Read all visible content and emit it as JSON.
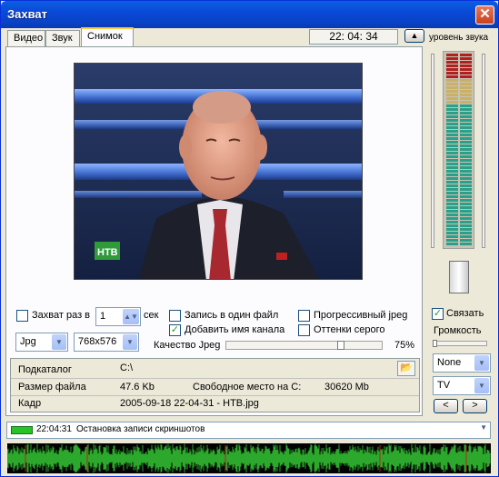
{
  "window": {
    "title": "Захват"
  },
  "tabs": [
    {
      "label": "Видео",
      "active": false
    },
    {
      "label": "Звук",
      "active": false
    },
    {
      "label": "Снимок",
      "active": true
    }
  ],
  "clock": "22: 04: 34",
  "level_label": "уровень звука",
  "video": {
    "channel_logo": "НТВ"
  },
  "capture": {
    "every_label": "Захват раз в",
    "every_checked": false,
    "interval_value": "1",
    "interval_unit": "сек",
    "single_file_label": "Запись в один файл",
    "single_file_checked": false,
    "add_channel_label": "Добавить имя канала",
    "add_channel_checked": true,
    "progressive_label": "Прогрессивный jpeg",
    "progressive_checked": false,
    "grayscale_label": "Оттенки серого",
    "grayscale_checked": false,
    "format_value": "Jpg",
    "size_value": "768x576",
    "quality_label": "Качество Jpeg",
    "quality_percent_text": "75%",
    "quality_value": 0.75
  },
  "info": {
    "subdir_label": "Подкаталог",
    "subdir_value": "C:\\",
    "filesize_label": "Размер файла",
    "filesize_value": "47.6 Kb",
    "freespace_label": "Свободное место на C:",
    "freespace_value": "30620 Mb",
    "frame_label": "Кадр",
    "frame_value": "2005-09-18 22-04-31 - НТВ.jpg"
  },
  "right_panel": {
    "link_label": "Связать",
    "link_checked": true,
    "volume_label": "Громкость",
    "combo1_value": "None",
    "combo2_value": "TV",
    "prev_label": "<",
    "next_label": ">"
  },
  "status": {
    "time": "22:04:31",
    "message": "Остановка записи скриншотов"
  },
  "colors": {
    "title_bar": "#0a49d8",
    "meter_green": "#2aa08a",
    "meter_yellow": "#c8b068",
    "meter_red": "#b02020",
    "wave_green": "#2ca82c",
    "status_green": "#26c426"
  }
}
